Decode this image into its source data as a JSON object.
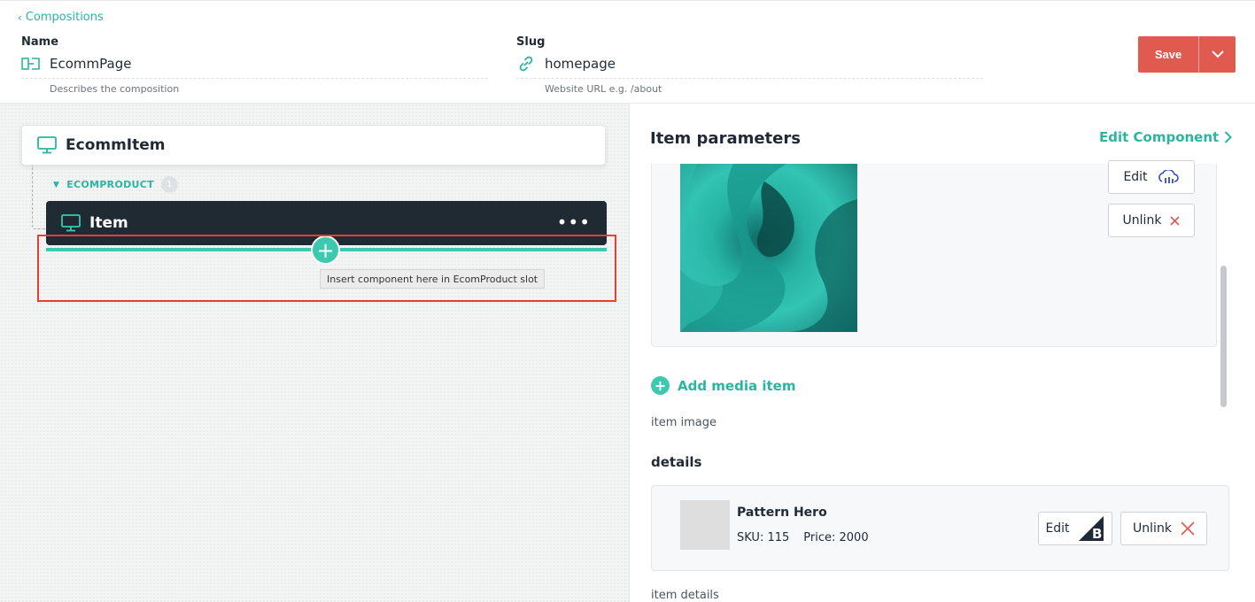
{
  "header": {
    "back_label": "Compositions",
    "name": {
      "label": "Name",
      "value": "EcommPage",
      "hint": "Describes the composition"
    },
    "slug": {
      "label": "Slug",
      "value": "homepage",
      "hint": "Website URL e.g. /about"
    },
    "save_label": "Save"
  },
  "canvas": {
    "root_component": "EcommItem",
    "slot": {
      "name": "ECOMPRODUCT",
      "count": "1"
    },
    "child_component": "Item",
    "more_label": "•••",
    "insert_tooltip": "Insert component here in EcomProduct slot"
  },
  "panel": {
    "title": "Item parameters",
    "edit_component_label": "Edit Component",
    "media": {
      "edit_label": "Edit",
      "unlink_label": "Unlink",
      "add_media_label": "Add media item",
      "caption": "item image"
    },
    "details": {
      "section_title": "details",
      "product_name": "Pattern Hero",
      "sku": "SKU: 115",
      "price": "Price: 2000",
      "edit_label": "Edit",
      "unlink_label": "Unlink",
      "caption": "item details"
    }
  },
  "colors": {
    "accent": "#2bb5a0",
    "save": "#e05a4f",
    "dark_card": "#1f2a33",
    "highlight": "#e8402f"
  }
}
